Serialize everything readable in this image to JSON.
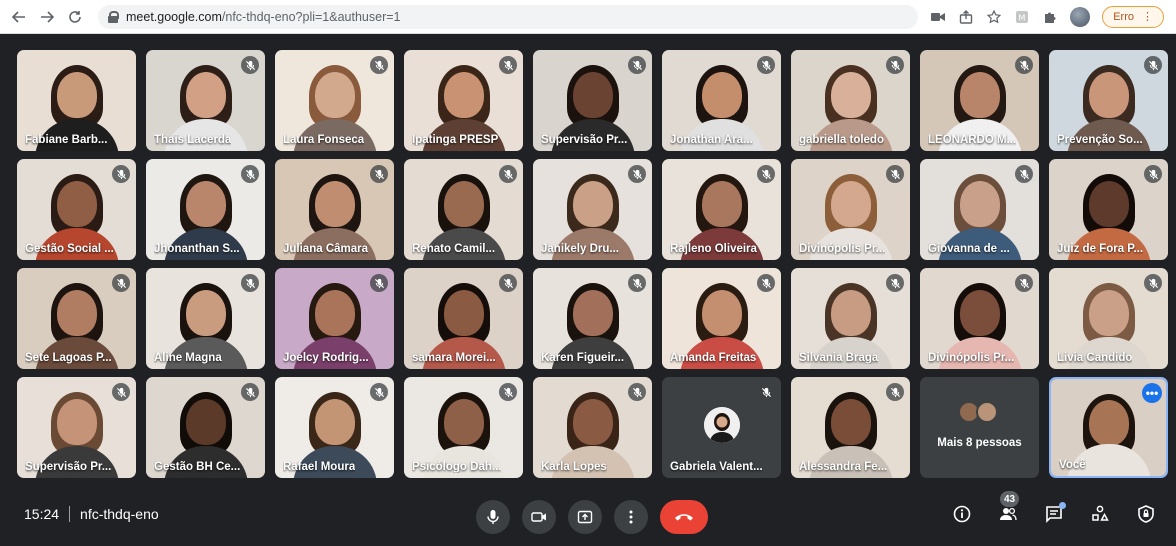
{
  "browser": {
    "url_host": "meet.google.com",
    "url_path": "/nfc-thdq-eno?pli=1&authuser=1",
    "erro_label": "Erro",
    "icons": [
      "back-icon",
      "forward-icon",
      "reload-icon",
      "lock-icon",
      "camera-blocked-icon",
      "share-icon",
      "star-icon",
      "extension-icon",
      "puzzle-icon",
      "profile-avatar",
      "kebab-menu-icon"
    ]
  },
  "participants": [
    {
      "name": "Fabiane Barb...",
      "muted": false,
      "highlight": "none",
      "skin": "#c99a7a",
      "hair": "#2b1d16",
      "shirt": "#1e1e1e",
      "bg": "#e9ded4"
    },
    {
      "name": "Thais Lacerda",
      "muted": true,
      "highlight": "none",
      "skin": "#d2a185",
      "hair": "#2d1f18",
      "shirt": "#e6e6e6",
      "bg": "#d9d5cf"
    },
    {
      "name": "Laura Fonseca",
      "muted": true,
      "highlight": "none",
      "skin": "#d3a98d",
      "hair": "#8a5a3c",
      "shirt": "#7a6a62",
      "bg": "#efe7dc"
    },
    {
      "name": "Ipatinga PRESP",
      "muted": true,
      "highlight": "none",
      "skin": "#c99272",
      "hair": "#3a2518",
      "shirt": "#5d4033",
      "bg": "#eadfd6"
    },
    {
      "name": "Supervisão Pr...",
      "muted": true,
      "highlight": "none",
      "skin": "#6b4332",
      "hair": "#1b120d",
      "shirt": "#2a2a2a",
      "bg": "#d9d4ce"
    },
    {
      "name": "Jonathan Ara...",
      "muted": true,
      "highlight": "none",
      "skin": "#c48e6d",
      "hair": "#1d1410",
      "shirt": "#e0e0e0",
      "bg": "#e1dad2"
    },
    {
      "name": "gabriella toledo",
      "muted": true,
      "highlight": "speaking",
      "skin": "#d9b19a",
      "hair": "#4a3020",
      "shirt": "#b99a8a",
      "bg": "#dcd5cc"
    },
    {
      "name": "LEONARDO M...",
      "muted": true,
      "highlight": "none",
      "skin": "#b9856a",
      "hair": "#231912",
      "shirt": "#f0f0f0",
      "bg": "#d4c7b8"
    },
    {
      "name": "Prevenção So...",
      "muted": true,
      "highlight": "none",
      "skin": "#c9967a",
      "hair": "#3a2a20",
      "shirt": "#6f5a50",
      "bg": "#cfd8df"
    },
    {
      "name": "Gestão Social ...",
      "muted": true,
      "highlight": "none",
      "skin": "#8f5e45",
      "hair": "#2a1b14",
      "shirt": "#b6462e",
      "bg": "#e4ddd5"
    },
    {
      "name": "Jhonanthan S...",
      "muted": true,
      "highlight": "none",
      "skin": "#b9866b",
      "hair": "#201610",
      "shirt": "#2f3b4a",
      "bg": "#eceae7"
    },
    {
      "name": "Juliana Câmara",
      "muted": true,
      "highlight": "none",
      "skin": "#c08d70",
      "hair": "#1e1510",
      "shirt": "#8b6e60",
      "bg": "#d8c7b5"
    },
    {
      "name": "Renato Camil...",
      "muted": true,
      "highlight": "none",
      "skin": "#9a6a50",
      "hair": "#18110c",
      "shirt": "#4a4a4a",
      "bg": "#e4dcd3"
    },
    {
      "name": "Janikely Dru...",
      "muted": true,
      "highlight": "none",
      "skin": "#caa086",
      "hair": "#3b291c",
      "shirt": "#9c7a6a",
      "bg": "#e6e1dc"
    },
    {
      "name": "Rajleno Oliveira",
      "muted": true,
      "highlight": "none",
      "skin": "#a8775e",
      "hair": "#23170f",
      "shirt": "#7c3a3a",
      "bg": "#e9e2da"
    },
    {
      "name": "Divinópolis Pr...",
      "muted": true,
      "highlight": "none",
      "skin": "#d3a88f",
      "hair": "#8c5f3a",
      "shirt": "#e7e2dd",
      "bg": "#ddd3c8"
    },
    {
      "name": "Giovanna de ...",
      "muted": true,
      "highlight": "none",
      "skin": "#c9a08a",
      "hair": "#6b4e3c",
      "shirt": "#3d5b7a",
      "bg": "#e3dfda"
    },
    {
      "name": "Juiz de Fora P...",
      "muted": true,
      "highlight": "none",
      "skin": "#5d3a2b",
      "hair": "#120b08",
      "shirt": "#c46a43",
      "bg": "#dcd4ca"
    },
    {
      "name": "Sete Lagoas P...",
      "muted": true,
      "highlight": "none",
      "skin": "#b07d62",
      "hair": "#1d140f",
      "shirt": "#6a4a3a",
      "bg": "#d9cdbf"
    },
    {
      "name": "Aline Magna",
      "muted": true,
      "highlight": "none",
      "skin": "#c99c80",
      "hair": "#1a120d",
      "shirt": "#5a5a5a",
      "bg": "#e8e3dc"
    },
    {
      "name": "Joelcy Rodrig...",
      "muted": true,
      "highlight": "none",
      "skin": "#a9745a",
      "hair": "#251910",
      "shirt": "#7a3f6a",
      "bg": "#c8a9c8"
    },
    {
      "name": "samara Morei...",
      "muted": true,
      "highlight": "none",
      "skin": "#8a5a42",
      "hair": "#140d09",
      "shirt": "#b4584a",
      "bg": "#dcd2c7"
    },
    {
      "name": "Karen Figueir...",
      "muted": true,
      "highlight": "none",
      "skin": "#a2705a",
      "hair": "#1a120c",
      "shirt": "#3e3e3e",
      "bg": "#e8e2dc"
    },
    {
      "name": "Amanda Freitas",
      "muted": true,
      "highlight": "speaking",
      "skin": "#c48f70",
      "hair": "#2b1c12",
      "shirt": "#c94d45",
      "bg": "#efe4da"
    },
    {
      "name": "Silvania Braga",
      "muted": true,
      "highlight": "none",
      "skin": "#c79c83",
      "hair": "#4a3425",
      "shirt": "#d8d2cc",
      "bg": "#e6dfd8"
    },
    {
      "name": "Divinópolis Pr...",
      "muted": true,
      "highlight": "none",
      "skin": "#7a4e3a",
      "hair": "#140d09",
      "shirt": "#e6b6b0",
      "bg": "#e1d9cf"
    },
    {
      "name": "Livia Candido",
      "muted": true,
      "highlight": "none",
      "skin": "#caa089",
      "hair": "#7d5a44",
      "shirt": "#ddd7d0",
      "bg": "#e4dbd1"
    },
    {
      "name": "Supervisão Pr...",
      "muted": true,
      "highlight": "magenta",
      "skin": "#c59478",
      "hair": "#6b4a35",
      "shirt": "#3a3a3a",
      "bg": "#e8e0d8"
    },
    {
      "name": "Gestão BH Ce...",
      "muted": true,
      "highlight": "none",
      "skin": "#5c3a2a",
      "hair": "#120c08",
      "shirt": "#2d2d2d",
      "bg": "#ded7cf"
    },
    {
      "name": "Rafael Moura",
      "muted": true,
      "highlight": "none",
      "skin": "#c49575",
      "hair": "#3a2718",
      "shirt": "#3c4a5a",
      "bg": "#efece8"
    },
    {
      "name": "Psicólogo Dah...",
      "muted": true,
      "highlight": "none",
      "skin": "#8f6048",
      "hair": "#1b120c",
      "shirt": "#e8e4de",
      "bg": "#ebe7e2"
    },
    {
      "name": "Karla Lopes",
      "muted": true,
      "highlight": "none",
      "skin": "#8a5a42",
      "hair": "#3a2418",
      "shirt": "#d3c2b2",
      "bg": "#e3dbd2"
    }
  ],
  "avatar_tiles": [
    {
      "name": "Gabriela Valent...",
      "muted": true
    },
    {
      "name": "Alessandra Fe...",
      "muted": true
    }
  ],
  "more_tile": {
    "label": "Mais 8 pessoas"
  },
  "self_tile": {
    "name": "Você",
    "options_label": "•••"
  },
  "meeting": {
    "time": "15:24",
    "code": "nfc-thdq-eno",
    "participant_count": "43"
  },
  "colors": {
    "accent": "#1a73e8",
    "end_call": "#ea4335",
    "speaking": "#1fbf5f",
    "pinned": "#d33cd8"
  }
}
